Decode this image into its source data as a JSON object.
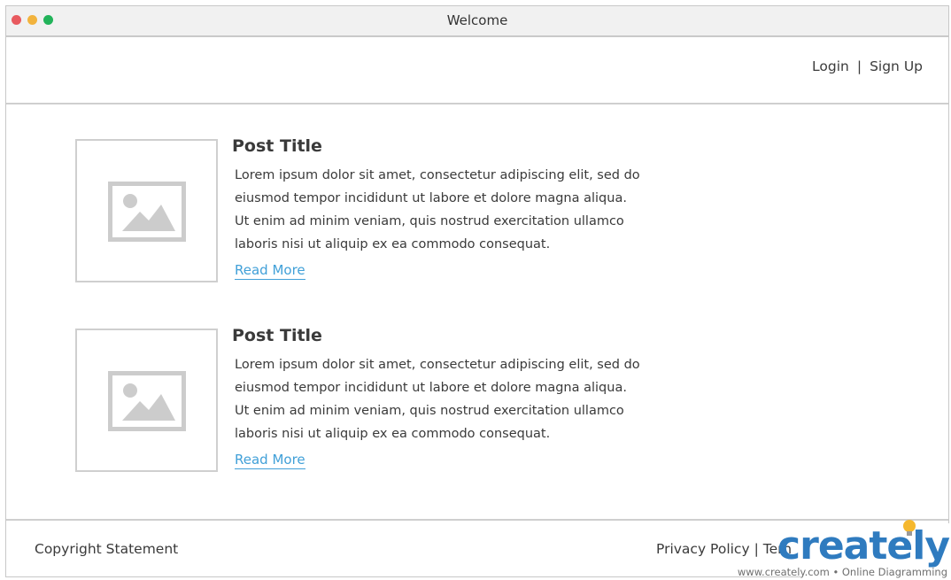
{
  "window": {
    "title": "Welcome"
  },
  "header": {
    "login_label": "Login",
    "separator": "|",
    "signup_label": "Sign Up"
  },
  "posts": [
    {
      "title": "Post Title",
      "body": "Lorem ipsum dolor sit amet, consectetur adipiscing elit, sed do\neiusmod tempor incididunt ut labore et dolore magna aliqua.\nUt enim ad minim veniam, quis nostrud exercitation ullamco\nlaboris nisi ut aliquip ex ea commodo consequat.",
      "link_label": "Read More",
      "image_icon": "image-placeholder-icon"
    },
    {
      "title": "Post Title",
      "body": "Lorem ipsum dolor sit amet, consectetur adipiscing elit, sed do\neiusmod tempor incididunt ut labore et dolore magna aliqua.\nUt enim ad minim veniam, quis nostrud exercitation ullamco\nlaboris nisi ut aliquip ex ea commodo consequat.",
      "link_label": "Read More",
      "image_icon": "image-placeholder-icon"
    }
  ],
  "footer": {
    "copyright": "Copyright Statement",
    "privacy_label": "Privacy Policy",
    "separator": "|",
    "terms_label": "Tern"
  },
  "watermark": {
    "brand": "creately",
    "tagline": "www.creately.com • Online Diagramming"
  },
  "colors": {
    "link": "#41a0d8",
    "traffic_red": "#e85a5f",
    "traffic_yellow": "#f2b33d",
    "traffic_green": "#22b35a",
    "brand_blue": "#2f7bbf"
  }
}
